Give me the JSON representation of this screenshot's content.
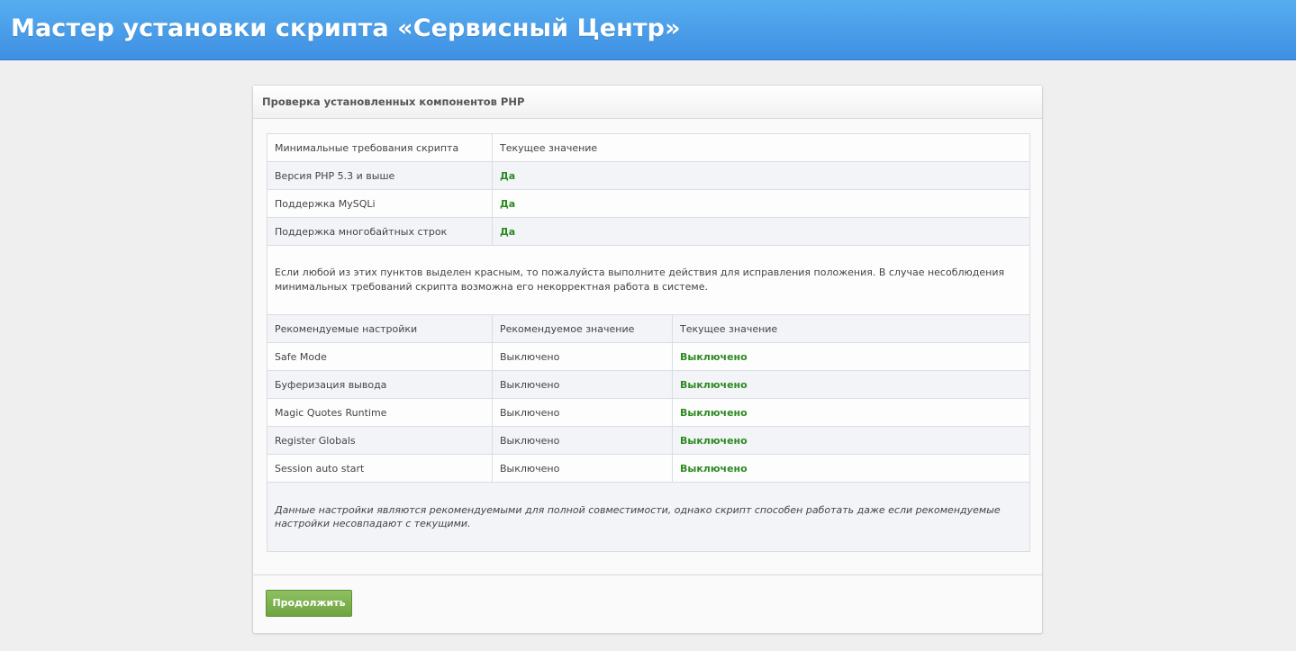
{
  "header": {
    "title": "Мастер установки скрипта «Сервисный Центр»"
  },
  "panel": {
    "title": "Проверка установленных компонентов PHP"
  },
  "requirements": {
    "col_requirement": "Минимальные требования скрипта",
    "col_current": "Текущее значение",
    "rows": [
      {
        "label": "Версия PHP 5.3 и выше",
        "value": "Да"
      },
      {
        "label": "Поддержка MySQLi",
        "value": "Да"
      },
      {
        "label": "Поддержка многобайтных строк",
        "value": "Да"
      }
    ],
    "note": "Если любой из этих пунктов выделен красным, то пожалуйста выполните действия для исправления положения. В случае несоблюдения минимальных требований скрипта возможна его некорректная работа в системе."
  },
  "settings": {
    "col_setting": "Рекомендуемые настройки",
    "col_recommended": "Рекомендуемое значение",
    "col_current": "Текущее значение",
    "rows": [
      {
        "label": "Safe Mode",
        "recommended": "Выключено",
        "current": "Выключено"
      },
      {
        "label": "Буферизация вывода",
        "recommended": "Выключено",
        "current": "Выключено"
      },
      {
        "label": "Magic Quotes Runtime",
        "recommended": "Выключено",
        "current": "Выключено"
      },
      {
        "label": "Register Globals",
        "recommended": "Выключено",
        "current": "Выключено"
      },
      {
        "label": "Session auto start",
        "recommended": "Выключено",
        "current": "Выключено"
      }
    ],
    "note": "Данные настройки являются рекомендуемыми для полной совместимости, однако скрипт способен работать даже если рекомендуемые настройки несовпадают с текущими."
  },
  "footer": {
    "continue_label": "Продолжить"
  },
  "colors": {
    "header": "#4a9fe9",
    "ok_text": "#2d8a22",
    "button": "#7eb34f"
  }
}
